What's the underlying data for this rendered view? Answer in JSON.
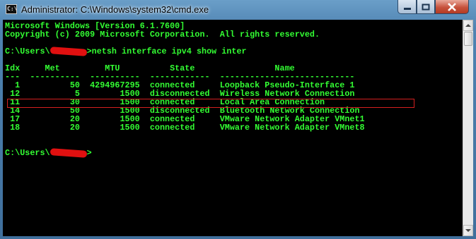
{
  "window": {
    "title": "Administrator: C:\\Windows\\system32\\cmd.exe",
    "icon_label": "C:\\",
    "controls": {
      "minimize_icon": "minimize-icon",
      "maximize_icon": "maximize-icon",
      "close_icon": "close-icon"
    }
  },
  "console": {
    "lines": [
      "Microsoft Windows [Version 6.1.7600]",
      "Copyright (c) 2009 Microsoft Corporation.  All rights reserved.",
      "",
      "",
      "",
      "Idx     Met         MTU          State                Name",
      "---  ----------  ----------  ------------  ---------------------------",
      "  1          50  4294967295  connected     Loopback Pseudo-Interface 1",
      " 12           5        1500  disconnected  Wireless Network Connection",
      " 11          30        1500  connected     Local Area Connection",
      " 14          50        1500  disconnected  Bluetooth Network Connection",
      " 17          20        1500  connected     VMware Network Adapter VMnet1",
      " 18          20        1500  connected     VMware Network Adapter VMnet8"
    ],
    "prompt_prefix": "C:\\Users\\",
    "command_suffix": ">netsh interface ipv4 show inter",
    "final_prompt_suffix": ">",
    "colors": {
      "text": "#33ff33",
      "background": "#000000",
      "highlight": "#d52020"
    }
  }
}
